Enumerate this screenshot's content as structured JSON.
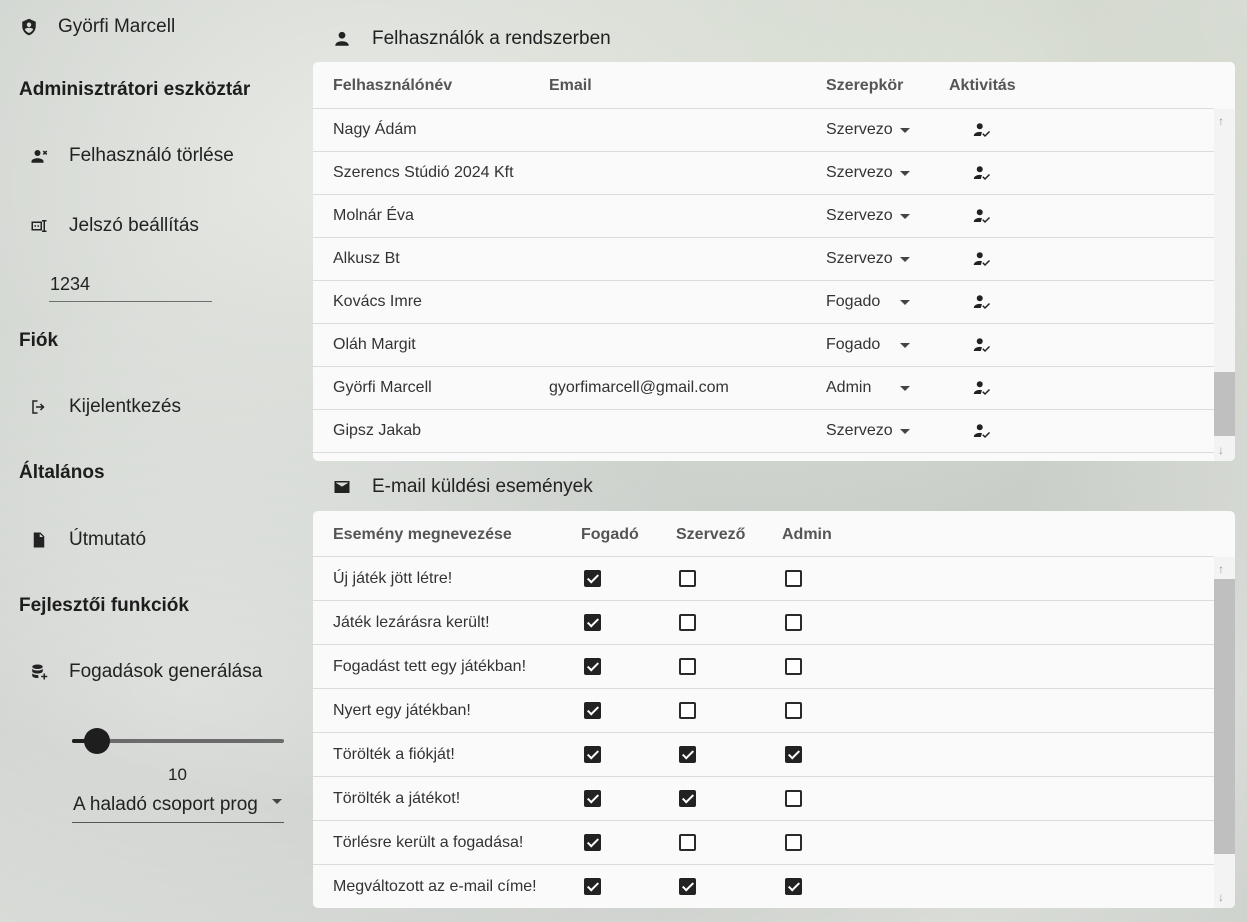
{
  "user": {
    "name": "Györfi Marcell"
  },
  "sidebar": {
    "admin_title": "Adminisztrátori eszköztár",
    "delete_user": "Felhasználó törlése",
    "password_set": "Jelszó beállítás",
    "password_value": "1234",
    "account_title": "Fiók",
    "logout": "Kijelentkezés",
    "general_title": "Általános",
    "guide": "Útmutató",
    "dev_title": "Fejlesztői funkciók",
    "generate_bets": "Fogadások generálása",
    "slider_value": "10",
    "slider_fraction": 0.12,
    "group_select": "A haladó csoport prog"
  },
  "users_panel": {
    "title": "Felhasználók a rendszerben",
    "headers": {
      "username": "Felhasználónév",
      "email": "Email",
      "role": "Szerepkör",
      "activity": "Aktivitás"
    },
    "rows": [
      {
        "username": "Nagy Ádám",
        "email": "",
        "role": "Szervezo"
      },
      {
        "username": "Szerencs Stúdió 2024 Kft",
        "email": "",
        "role": "Szervezo"
      },
      {
        "username": "Molnár Éva",
        "email": "",
        "role": "Szervezo"
      },
      {
        "username": "Alkusz Bt",
        "email": "",
        "role": "Szervezo"
      },
      {
        "username": "Kovács Imre",
        "email": "",
        "role": "Fogado"
      },
      {
        "username": "Oláh Margit",
        "email": "",
        "role": "Fogado"
      },
      {
        "username": "Györfi Marcell",
        "email": "gyorfimarcell@gmail.com",
        "role": "Admin"
      },
      {
        "username": "Gipsz Jakab",
        "email": "",
        "role": "Szervezo"
      }
    ]
  },
  "email_panel": {
    "title": "E-mail küldési események",
    "headers": {
      "event": "Esemény megnevezése",
      "receiver": "Fogadó",
      "organizer": "Szervező",
      "admin": "Admin"
    },
    "rows": [
      {
        "event": "Új játék jött létre!",
        "receiver": true,
        "organizer": false,
        "admin": false
      },
      {
        "event": "Játék lezárásra került!",
        "receiver": true,
        "organizer": false,
        "admin": false
      },
      {
        "event": "Fogadást tett egy játékban!",
        "receiver": true,
        "organizer": false,
        "admin": false
      },
      {
        "event": "Nyert egy játékban!",
        "receiver": true,
        "organizer": false,
        "admin": false
      },
      {
        "event": "Törölték a fiókját!",
        "receiver": true,
        "organizer": true,
        "admin": true
      },
      {
        "event": "Törölték a játékot!",
        "receiver": true,
        "organizer": true,
        "admin": false
      },
      {
        "event": "Törlésre került a fogadása!",
        "receiver": true,
        "organizer": false,
        "admin": false
      },
      {
        "event": "Megváltozott az e-mail címe!",
        "receiver": true,
        "organizer": true,
        "admin": true
      }
    ]
  }
}
